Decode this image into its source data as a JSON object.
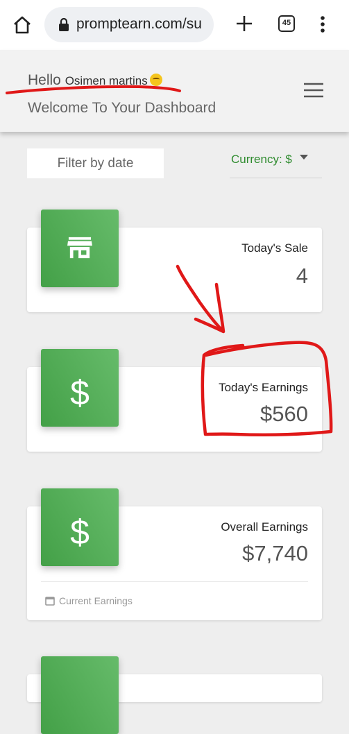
{
  "browser": {
    "url": "promptearn.com/su",
    "tab_count": "45",
    "icons": [
      "home-icon",
      "lock-icon",
      "plus-icon",
      "tabs-icon",
      "more-vert-icon"
    ]
  },
  "header": {
    "greeting": "Hello",
    "user_name": "Osimen martins",
    "welcome": "Welcome To Your Dashboard",
    "menu_icon": "hamburger-menu-icon"
  },
  "filters": {
    "date_filter_label": "Filter by date",
    "currency_label": "Currency: $"
  },
  "cards": [
    {
      "icon": "store-icon",
      "title": "Today's Sale",
      "value": "4"
    },
    {
      "icon": "dollar-icon",
      "title": "Today's Earnings",
      "value": "$560"
    },
    {
      "icon": "dollar-icon",
      "title": "Overall Earnings",
      "value": "$7,740",
      "footer": "Current Earnings",
      "footer_icon": "calendar-icon"
    }
  ],
  "colors": {
    "accent_green": "#43a047",
    "currency_green": "#2e8b2e",
    "annotation_red": "#e01818"
  }
}
